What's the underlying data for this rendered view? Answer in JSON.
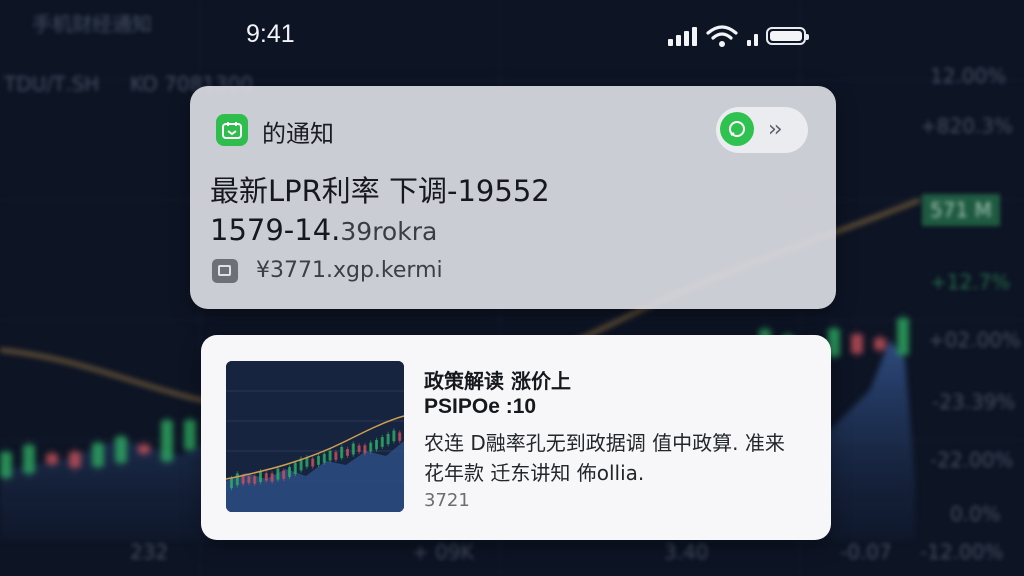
{
  "status_bar": {
    "time": "9:41"
  },
  "background": {
    "labels": {
      "top_left_a": "手机财经通知",
      "top_left_b": "ТDU/Т.SH",
      "top_left_c": "KO 7081300",
      "right_1": "12.00%",
      "right_2": "+820.3%",
      "right_3": "+12.7%",
      "right_4": "+02.00%",
      "right_5": "-23.39%",
      "right_6": "-22.00%",
      "right_7": "0.0%",
      "right_8": "-12.00%",
      "badge": "571 M",
      "bottom_1": "+ 09K",
      "bottom_2": "-0.07",
      "bottom_3": "3.40",
      "bottom_4": "232"
    }
  },
  "notification_primary": {
    "app_name": "的通知",
    "line1": "最新LPR利率 下调-19552",
    "line2_main": "1579-14.",
    "line2_faded": "39rokra",
    "source": "¥3771.xgp.kermi"
  },
  "notification_secondary": {
    "title": "政策解读 涨价上",
    "subtitle": "PSIPOe :10",
    "body_line1": "农连 D融率孔无到政据调 值中政算. 准来",
    "body_line2": "花年款 迁东讲知 佈ollia.",
    "time": "3721"
  },
  "colors": {
    "accent_green": "#2fbd4e",
    "candle_up": "#2fae63",
    "candle_down": "#c9525a"
  }
}
